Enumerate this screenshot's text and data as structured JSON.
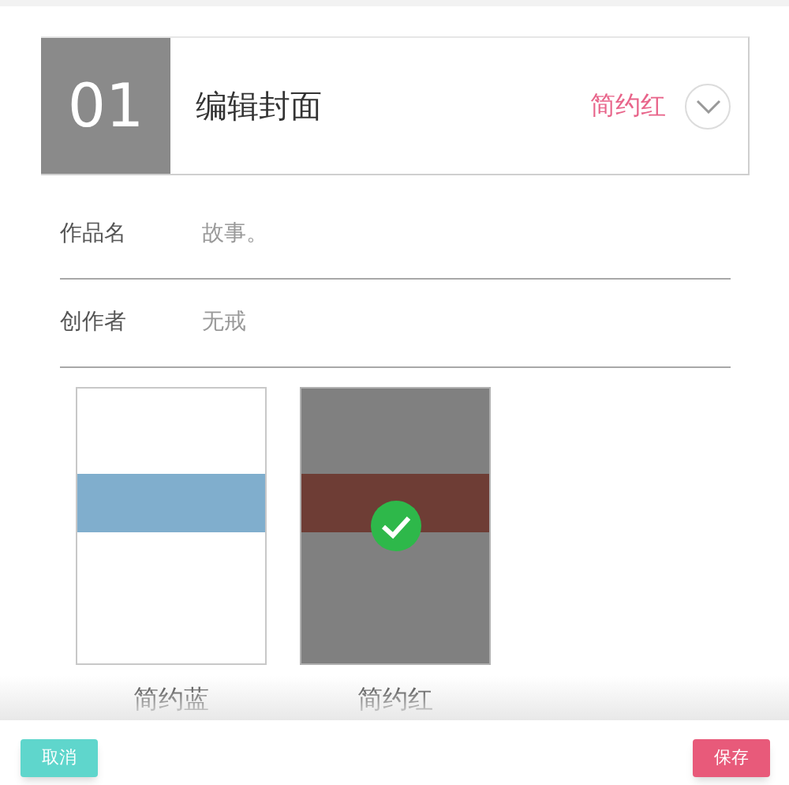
{
  "section": {
    "number": "01",
    "title": "编辑封面",
    "current_theme": "简约红",
    "expanded": false
  },
  "fields": [
    {
      "label": "作品名",
      "value": "故事。"
    },
    {
      "label": "创作者",
      "value": "无戒"
    }
  ],
  "themes": [
    {
      "name": "简约蓝",
      "color": "#80aecd",
      "selected": false
    },
    {
      "name": "简约红",
      "color": "#6e3d35",
      "selected": true
    }
  ],
  "buttons": {
    "cancel": "取消",
    "save": "保存"
  }
}
